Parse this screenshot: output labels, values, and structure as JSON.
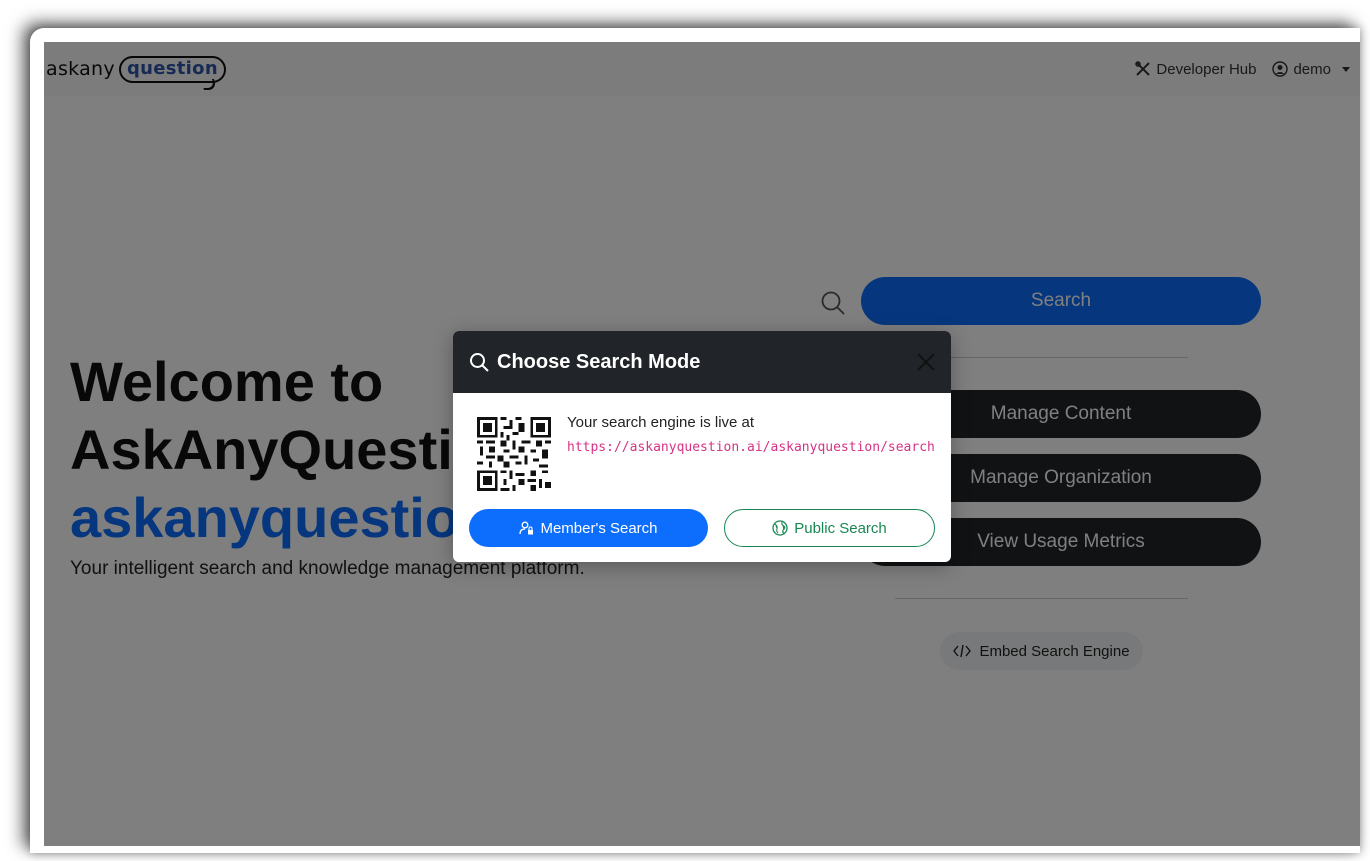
{
  "navbar": {
    "brand_left": "askany",
    "brand_right": "question",
    "developer_hub": "Developer Hub",
    "user": "demo"
  },
  "hero": {
    "line1": "Welcome to",
    "line2": "AskAnyQuestion",
    "line3": "askanyquestion",
    "subtitle": "Your intelligent search and knowledge management platform."
  },
  "actions": {
    "search": "Search",
    "manage_content": "Manage Content",
    "manage_organization": "Manage Organization",
    "view_usage_metrics": "View Usage Metrics",
    "embed": "Embed Search Engine"
  },
  "modal": {
    "title": "Choose Search Mode",
    "live_text": "Your search engine is live at",
    "url": "https://askanyquestion.ai/askanyquestion/search",
    "member_search": "Member's Search",
    "public_search": "Public Search"
  },
  "colors": {
    "primary": "#0d6efd",
    "dark": "#212529",
    "success": "#198754",
    "url": "#d63384"
  }
}
